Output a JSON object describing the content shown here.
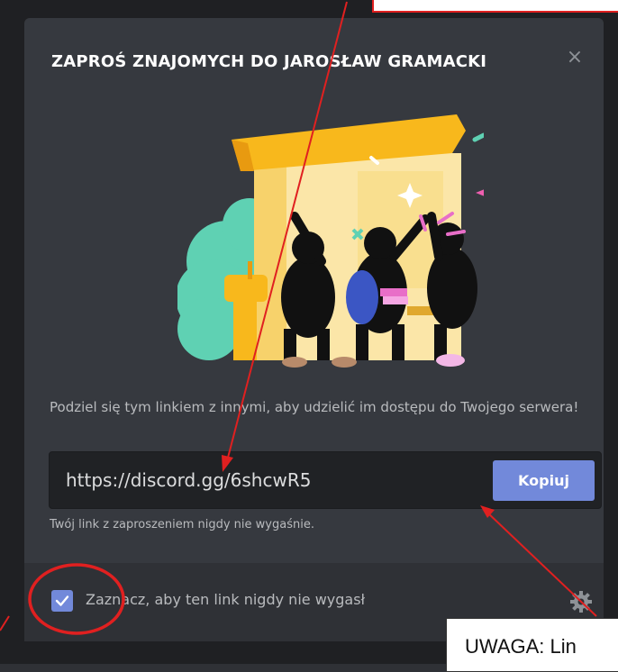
{
  "modal": {
    "title": "ZAPROŚ ZNAJOMYCH DO JAROSŁAW GRAMACKI",
    "close_label": "×",
    "description": "Podziel się tym linkiem z innymi, aby udzielić im dostępu do Twojego serwera!",
    "invite_link": "https://discord.gg/6shcwR5",
    "copy_label": "Kopiuj",
    "expire_note": "Twój link z zaproszeniem nigdy nie wygaśnie.",
    "never_expire_label": "Zaznacz, aby ten link nigdy nie wygasł",
    "never_expire_checked": true
  },
  "annotation": {
    "warning_text": "UWAGA: Lin"
  },
  "colors": {
    "modal_bg": "#36393f",
    "footer_bg": "#2f3136",
    "accent": "#7289da",
    "annotation_red": "#e02020"
  },
  "icons": {
    "close": "close-icon",
    "check": "check-icon",
    "settings": "gear-icon"
  }
}
